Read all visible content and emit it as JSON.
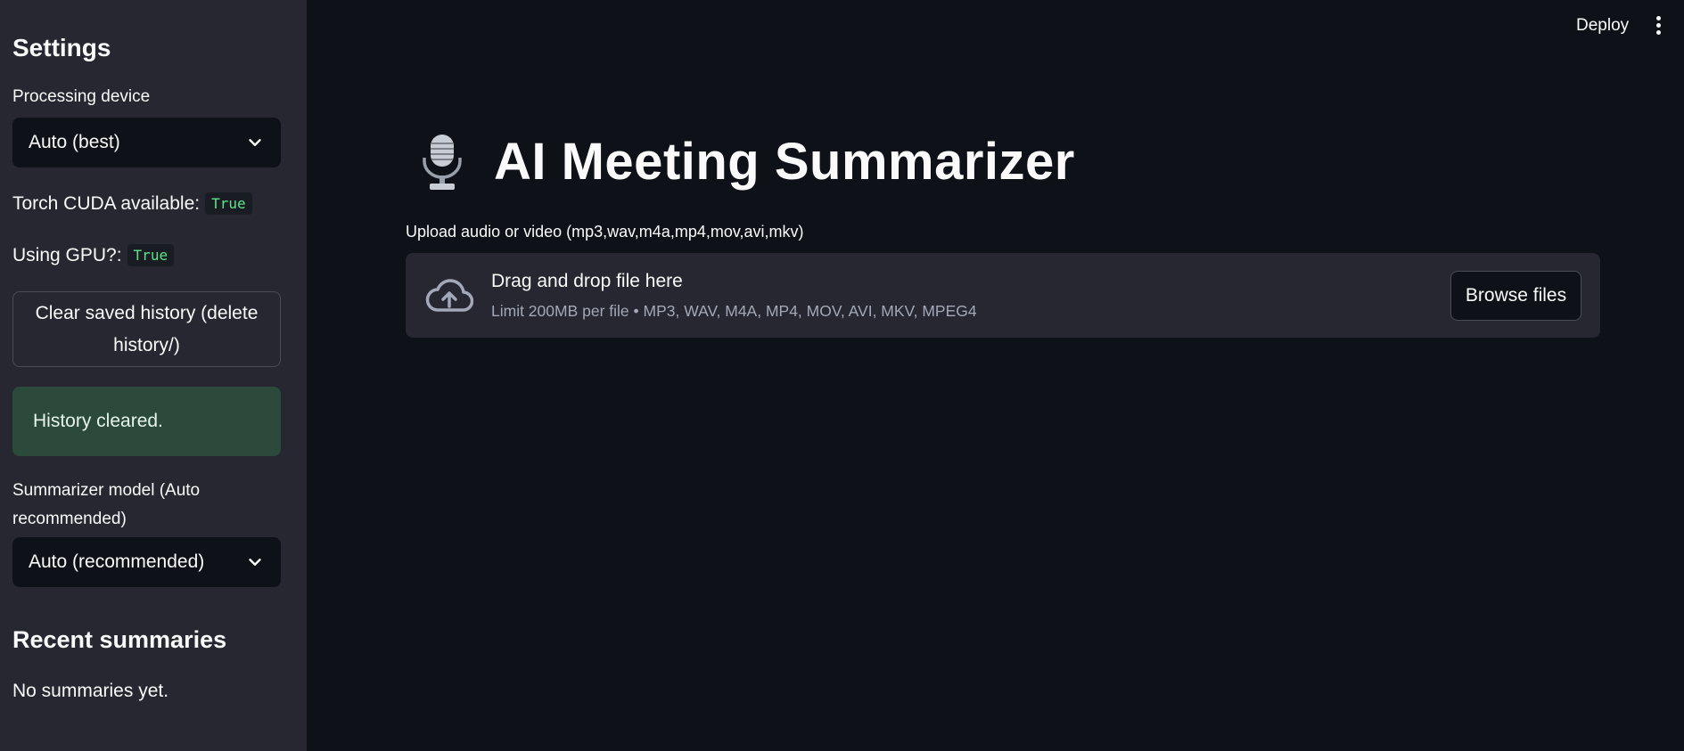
{
  "sidebar": {
    "title": "Settings",
    "device_label": "Processing device",
    "device_value": "Auto (best)",
    "cuda_label": "Torch CUDA available:",
    "cuda_value": "True",
    "gpu_label": "Using GPU?:",
    "gpu_value": "True",
    "clear_button": "Clear saved history (delete history/)",
    "alert_text": "History cleared.",
    "model_label": "Summarizer model (Auto recommended)",
    "model_value": "Auto (recommended)",
    "recent_title": "Recent summaries",
    "recent_empty": "No summaries yet."
  },
  "header": {
    "deploy_label": "Deploy",
    "menu_icon": "kebab-menu-icon"
  },
  "main": {
    "title_icon": "microphone-icon",
    "title": "AI Meeting Summarizer",
    "upload_label": "Upload audio or video (mp3,wav,m4a,mp4,mov,avi,mkv)",
    "dropzone": {
      "icon": "cloud-upload-icon",
      "title": "Drag and drop file here",
      "subtitle": "Limit 200MB per file • MP3, WAV, M4A, MP4, MOV, AVI, MKV, MPEG4",
      "browse_label": "Browse files"
    }
  },
  "colors": {
    "background": "#0e1117",
    "sidebar": "#262730",
    "success": "#2b4a3b",
    "code_text": "#5ce488"
  }
}
